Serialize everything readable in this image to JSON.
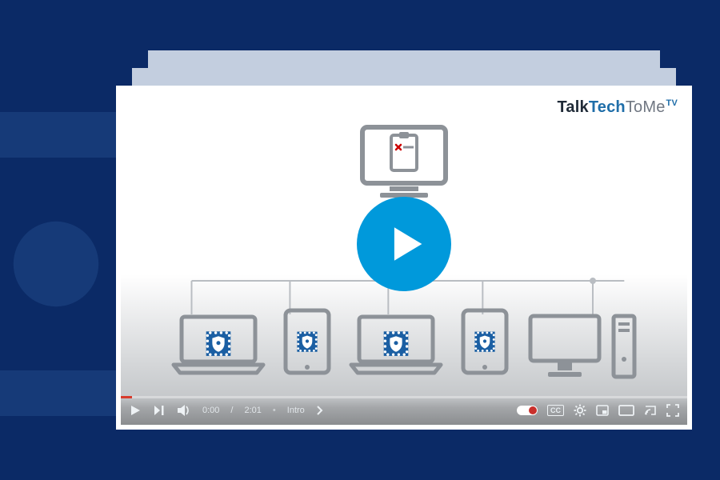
{
  "brand": {
    "p1": "Talk",
    "p2": "Tech",
    "p3": "ToMe",
    "p4": "TV"
  },
  "diagram": {
    "server_icon": "monitor-clipboard-icon",
    "devices": [
      {
        "type": "laptop",
        "badge": "shield-icon"
      },
      {
        "type": "tablet",
        "badge": "shield-icon"
      },
      {
        "type": "laptop",
        "badge": "shield-icon"
      },
      {
        "type": "tablet",
        "badge": "shield-icon"
      },
      {
        "type": "desktop",
        "badge": null
      }
    ]
  },
  "player": {
    "play_label": "Play",
    "time_current": "0:00",
    "time_total": "2:01",
    "chapter": "Intro",
    "autoplay_on": true,
    "cc_label": "CC",
    "icons": {
      "play": "play-icon",
      "next": "next-icon",
      "volume": "volume-icon",
      "settings": "gear-icon",
      "miniplayer": "miniplayer-icon",
      "theater": "theater-icon",
      "cast": "cast-icon",
      "fullscreen": "fullscreen-icon",
      "chapter_chevron": "chevron-right-icon"
    }
  },
  "colors": {
    "background": "#0b2a66",
    "card": "#c3cedf",
    "accent": "#1f6ea9",
    "play_button": "#0099db",
    "badge": "#1b5fa3"
  }
}
